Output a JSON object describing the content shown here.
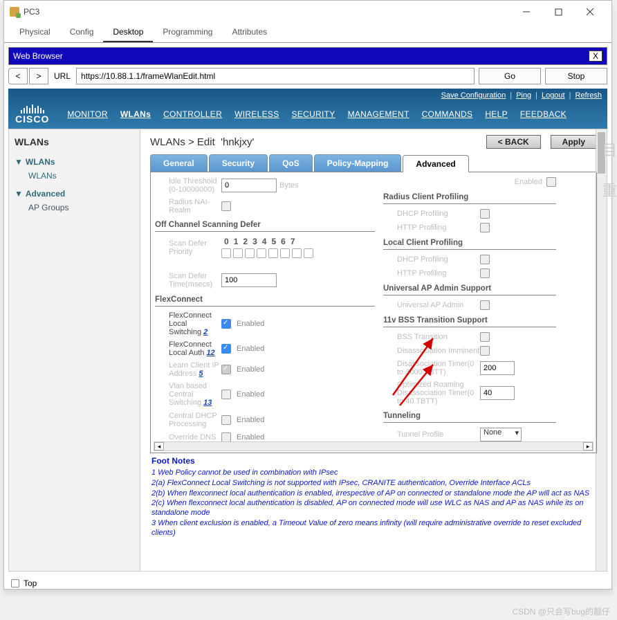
{
  "window": {
    "title": "PC3"
  },
  "tabs": [
    "Physical",
    "Config",
    "Desktop",
    "Programming",
    "Attributes"
  ],
  "active_tab": "Desktop",
  "webbar": {
    "title": "Web Browser",
    "close": "X"
  },
  "addr": {
    "back": "<",
    "fwd": ">",
    "label": "URL",
    "url": "https://10.88.1.1/frameWlanEdit.html",
    "go": "Go",
    "stop": "Stop"
  },
  "cisco": {
    "logo": "CISCO",
    "top_links": [
      "Save Configuration",
      "Ping",
      "Logout",
      "Refresh"
    ],
    "nav": [
      "MONITOR",
      "WLANs",
      "CONTROLLER",
      "WIRELESS",
      "SECURITY",
      "MANAGEMENT",
      "COMMANDS",
      "HELP",
      "FEEDBACK"
    ],
    "nav_active": "WLANs"
  },
  "sidebar": {
    "heading": "WLANs",
    "items": [
      {
        "label": "WLANs",
        "children": [
          "WLANs"
        ]
      },
      {
        "label": "Advanced",
        "children": [
          "AP Groups"
        ]
      }
    ]
  },
  "main": {
    "breadcrumb": "WLANs > Edit",
    "wlan_name": "'hnkjxy'",
    "back_btn": "< BACK",
    "apply_btn": "Apply",
    "subtabs": [
      "General",
      "Security",
      "QoS",
      "Policy-Mapping",
      "Advanced"
    ],
    "subtab_active": "Advanced",
    "left": {
      "idle_label": "Idle Threshold (0-10000000)",
      "idle_value": "0",
      "idle_unit": "Bytes",
      "radius_nai": "Radius NAI-Realm",
      "section_off": "Off Channel Scanning Defer",
      "scan_prio": "Scan Defer Priority",
      "scan_time": "Scan Defer Time(msecs)",
      "scan_time_val": "100",
      "section_flex": "FlexConnect",
      "flex_switching": "FlexConnect Local Switching",
      "flex_switching_note": "2",
      "flex_auth": "FlexConnect Local Auth",
      "flex_auth_note": "12",
      "learn_ip": "Learn Client IP Address",
      "learn_ip_note": "5",
      "vlan_switch": "Vlan based Central Switching",
      "vlan_switch_note": "13",
      "central_dhcp": "Central DHCP Processing",
      "override_dns": "Override DNS",
      "enabled": "Enabled"
    },
    "right": {
      "enabled_pre": "Enabled",
      "section_radius": "Radius Client Profiling",
      "dhcp_prof": "DHCP Profiling",
      "http_prof": "HTTP Profiling",
      "section_local": "Local Client Profiling",
      "section_univ": "Universal AP Admin Support",
      "univ_admin": "Universal AP Admin",
      "section_11v": "11v BSS Transition Support",
      "bss_transition": "BSS Transition",
      "disassoc_imm": "Disassociation Imminent",
      "disassoc_timer": "Disassociation Timer(0 to 3000 TBTT)",
      "disassoc_val": "200",
      "opt_roam": "Optimized Roaming Disassociation Timer(0 to 40 TBTT)",
      "opt_roam_val": "40",
      "section_tunnel": "Tunneling",
      "tunnel_profile": "Tunnel Profile",
      "tunnel_val": "None"
    },
    "footnotes": {
      "heading": "Foot Notes",
      "n1": "1 Web Policy cannot be used in combination with IPsec",
      "n2a": "2(a) FlexConnect Local Switching is not supported with IPsec, CRANITE authentication, Override Interface ACLs",
      "n2b": "2(b) When flexconnect local authentication is enabled, irrespective of AP on connected or standalone mode the AP will act as NAS",
      "n2c": "2(c) When flexconnect local authentication is disabled, AP on connected mode will use WLC as NAS and AP as NAS while its on standalone mode",
      "n3": "3 When client exclusion is enabled, a Timeout Value of zero means infinity (will require administrative override to reset excluded clients)"
    }
  },
  "bottom": {
    "top": "Top"
  },
  "watermark": "CSDN @只会写bug的靓仔"
}
